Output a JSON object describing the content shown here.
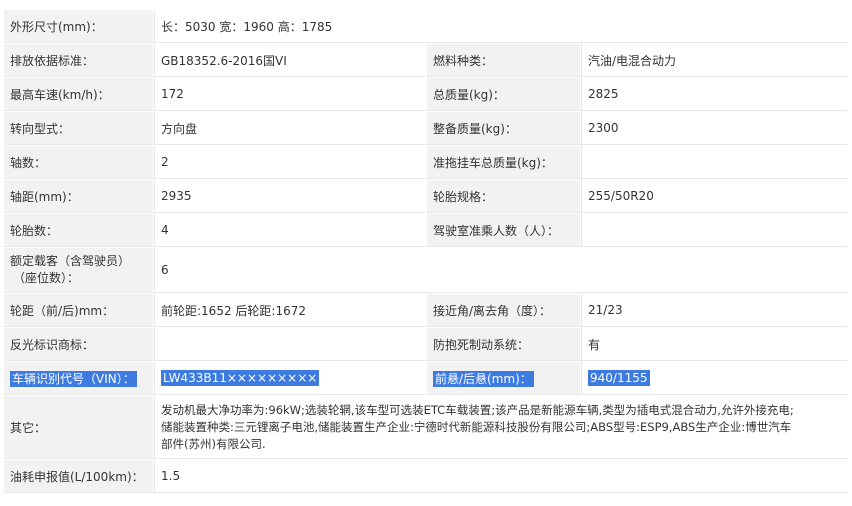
{
  "rows": {
    "r0": {
      "l1": "外形尺寸(mm)：",
      "v1": "长：5030 宽：1960 高：1785"
    },
    "r1": {
      "l1": "排放依据标准：",
      "v1": "GB18352.6-2016国VI",
      "l2": "燃料种类：",
      "v2": "汽油/电混合动力"
    },
    "r2": {
      "l1": "最高车速(km/h)：",
      "v1": "172",
      "l2": "总质量(kg)：",
      "v2": "2825"
    },
    "r3": {
      "l1": "转向型式：",
      "v1": "方向盘",
      "l2": "整备质量(kg)：",
      "v2": "2300"
    },
    "r4": {
      "l1": "轴数：",
      "v1": "2",
      "l2": "准拖挂车总质量(kg)：",
      "v2": ""
    },
    "r5": {
      "l1": "轴距(mm)：",
      "v1": "2935",
      "l2": "轮胎规格：",
      "v2": "255/50R20"
    },
    "r6": {
      "l1": "轮胎数：",
      "v1": "4",
      "l2": "驾驶室准乘人数（人）：",
      "v2": ""
    },
    "r7": {
      "l1a": "额定载客（含驾驶员）",
      "l1b": "（座位数）：",
      "v1": "6"
    },
    "r8": {
      "l1": "轮距（前/后)mm：",
      "v1": "前轮距:1652 后轮距:1672",
      "l2": "接近角/离去角（度）：",
      "v2": "21/23"
    },
    "r9": {
      "l1": "反光标识商标：",
      "v1": "",
      "l2": "防抱死制动系统：",
      "v2": "有"
    },
    "r10": {
      "l1": "车辆识别代号（VIN）：",
      "v1": "LW433B11×××××××××",
      "l2": "前悬/后悬(mm)：",
      "v2": "940/1155"
    },
    "r11": {
      "l1": "其它：",
      "v1a": "发动机最大净功率为:96kW;选装轮辋,该车型可选装ETC车载装置;该产品是新能源车辆,类型为插电式混合动力,允许外接充电;",
      "v1b": "储能装置种类:三元锂离子电池,储能装置生产企业:宁德时代新能源科技股份有限公司;ABS型号:ESP9,ABS生产企业:博世汽车",
      "v1c": "部件(苏州)有限公司."
    },
    "r12": {
      "l1": "油耗申报值(L/100km)：",
      "v1": "1.5"
    }
  }
}
